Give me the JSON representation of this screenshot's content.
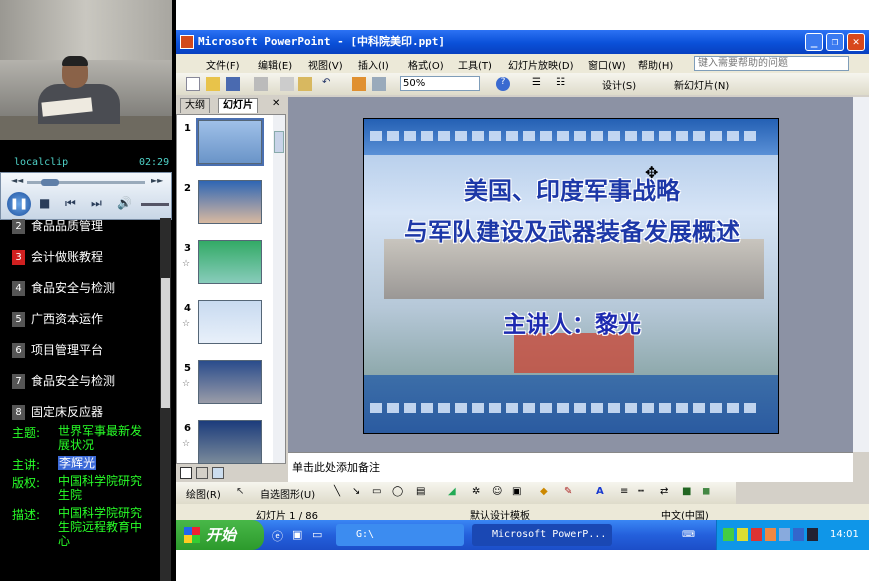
{
  "player": {
    "clip_name": "localclip",
    "time": "02:29",
    "play_state": "paused",
    "seek_left": "◄◄",
    "seek_right": "►►"
  },
  "course_list": {
    "items": [
      {
        "num": "2",
        "label": "食品品质管理",
        "hot": false
      },
      {
        "num": "3",
        "label": "会计做账教程",
        "hot": true
      },
      {
        "num": "4",
        "label": "食品安全与检测",
        "hot": false
      },
      {
        "num": "5",
        "label": "广西资本运作",
        "hot": false
      },
      {
        "num": "6",
        "label": "项目管理平台",
        "hot": false
      },
      {
        "num": "7",
        "label": "食品安全与检测",
        "hot": false
      },
      {
        "num": "8",
        "label": "固定床反应器",
        "hot": false
      }
    ]
  },
  "info": {
    "topic_label": "主题:",
    "topic_value": "世界军事最新发展状况",
    "lecturer_label": "主讲:",
    "lecturer_value": "李辉光",
    "copyright_label": "版权:",
    "copyright_value": "中国科学院研究生院",
    "desc_label": "描述:",
    "desc_value": "中国科学院研究生院远程教育中心"
  },
  "ppt": {
    "window_title": "Microsoft PowerPoint - [中科院美印.ppt]",
    "menu": [
      "文件(F)",
      "编辑(E)",
      "视图(V)",
      "插入(I)",
      "格式(O)",
      "工具(T)",
      "幻灯片放映(D)",
      "窗口(W)",
      "帮助(H)"
    ],
    "help_placeholder": "键入需要帮助的问题",
    "zoom": "50%",
    "design_label": "设计(S)",
    "new_slide_label": "新幻灯片(N)",
    "tab_outline": "大纲",
    "tab_slides": "幻灯片",
    "thumbnails": [
      "1",
      "2",
      "3",
      "4",
      "5",
      "6"
    ],
    "slide": {
      "line1": "美国、印度军事战略",
      "line2": "与军队建设及武器装备发展概述",
      "line3": "主讲人：黎光"
    },
    "notes_placeholder": "单击此处添加备注",
    "draw_label": "绘图(R)",
    "autoshape_label": "自选图形(U)",
    "status_slide": "幻灯片 1 / 86",
    "status_template": "默认设计模板",
    "status_lang": "中文(中国)"
  },
  "taskbar": {
    "start": "开始",
    "item_explorer": "G:\\",
    "item_ppt": "Microsoft PowerP...",
    "clock": "14:01"
  },
  "colors": {
    "xp_blue": "#0a50d8",
    "start_green": "#2c9a2c",
    "info_green": "#28ff28",
    "clip_teal": "#4fd3c9"
  }
}
